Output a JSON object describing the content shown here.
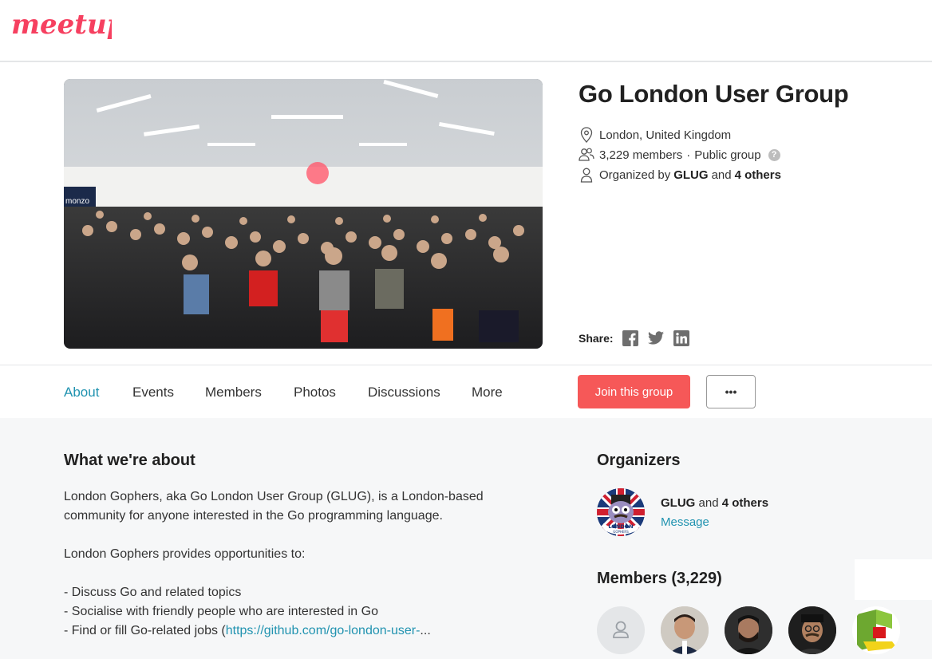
{
  "brand": {
    "logo_text": "meetup",
    "color": "#f64060"
  },
  "group": {
    "title": "Go London User Group",
    "location": "London, United Kingdom",
    "members": "3,229 members",
    "separator": "·",
    "visibility": "Public group",
    "help": "?",
    "organized_prefix": "Organized by",
    "organizer_name": "GLUG",
    "organized_and": "and",
    "organizer_others": "4 others"
  },
  "share": {
    "label": "Share:",
    "icons": [
      "facebook-icon",
      "twitter-icon",
      "linkedin-icon"
    ]
  },
  "tabs": [
    "About",
    "Events",
    "Members",
    "Photos",
    "Discussions",
    "More"
  ],
  "active_tab": "About",
  "actions": {
    "join_label": "Join this group",
    "more_label": "•••",
    "join_color": "#f65858"
  },
  "about": {
    "heading": "What we're about",
    "para1": "London Gophers, aka Go London User Group (GLUG), is a London-based community for anyone interested in the Go programming language.",
    "para2": "London Gophers provides opportunities to:",
    "bullet1": "- Discuss Go and related topics",
    "bullet2": "- Socialise with friendly people who are interested in Go",
    "bullet3_prefix": "- Find or fill Go-related jobs (",
    "bullet3_link": "https://github.com/go-london-user-",
    "bullet3_suffix": "..."
  },
  "organizers": {
    "heading": "Organizers",
    "name": "GLUG",
    "and": "and",
    "others": "4 others",
    "message": "Message",
    "badge_text_1": "LONDON",
    "badge_text_2": "GOPHERS"
  },
  "members_section": {
    "heading": "Members (3,229)"
  },
  "colors": {
    "accent": "#2193b0",
    "page_bg": "#f6f7f8"
  }
}
